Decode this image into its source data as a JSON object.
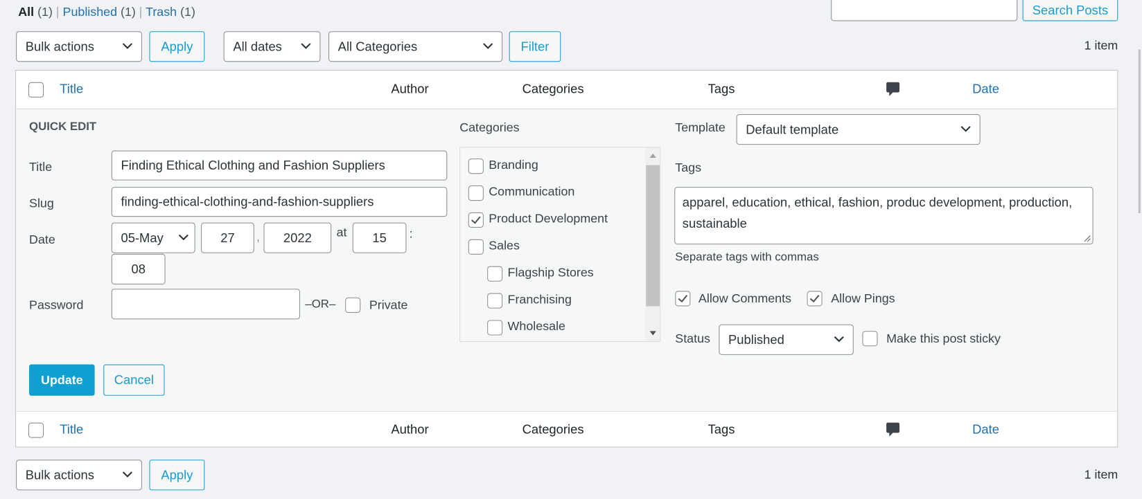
{
  "status_links": [
    {
      "label": "All",
      "count": "(1)",
      "current": true
    },
    {
      "label": "Published",
      "count": "(1)"
    },
    {
      "label": "Trash",
      "count": "(1)"
    }
  ],
  "search": {
    "value": "",
    "button": "Search Posts"
  },
  "top_nav": {
    "bulk_actions": "Bulk actions",
    "apply": "Apply",
    "dates": "All dates",
    "categories": "All Categories",
    "filter": "Filter",
    "count": "1 item"
  },
  "bottom_nav": {
    "bulk_actions": "Bulk actions",
    "apply": "Apply",
    "count": "1 item"
  },
  "columns": {
    "title": "Title",
    "author": "Author",
    "categories": "Categories",
    "tags": "Tags",
    "comments_icon": "comment-bubble-icon",
    "date": "Date"
  },
  "quick_edit": {
    "heading": "QUICK EDIT",
    "title_label": "Title",
    "title_value": "Finding Ethical Clothing and Fashion Suppliers",
    "slug_label": "Slug",
    "slug_value": "finding-ethical-clothing-and-fashion-suppliers",
    "date_label": "Date",
    "month": "05-May",
    "day": "27",
    "comma": ",",
    "year": "2022",
    "at": "at",
    "hour": "15",
    "colon": ":",
    "minute": "08",
    "password_label": "Password",
    "password_value": "",
    "or": "–OR–",
    "private_label": "Private",
    "private_checked": false,
    "categories_label": "Categories",
    "categories": [
      {
        "label": "Branding",
        "checked": false,
        "child": false
      },
      {
        "label": "Communication",
        "checked": false,
        "child": false
      },
      {
        "label": "Product Development",
        "checked": true,
        "child": false
      },
      {
        "label": "Sales",
        "checked": false,
        "child": false
      },
      {
        "label": "Flagship Stores",
        "checked": false,
        "child": true
      },
      {
        "label": "Franchising",
        "checked": false,
        "child": true
      },
      {
        "label": "Wholesale",
        "checked": false,
        "child": true
      }
    ],
    "template_label": "Template",
    "template_value": "Default template",
    "tags_label": "Tags",
    "tags_value": "apparel, education, ethical, fashion, produc development, production, sustainable",
    "tags_hint": "Separate tags with commas",
    "allow_comments": "Allow Comments",
    "allow_comments_checked": true,
    "allow_pings": "Allow Pings",
    "allow_pings_checked": true,
    "status_label": "Status",
    "status_value": "Published",
    "sticky_label": "Make this post sticky",
    "sticky_checked": false,
    "update": "Update",
    "cancel": "Cancel"
  },
  "colors": {
    "link": "#2271b1",
    "accent": "#1a9ccf",
    "primary_button": "#0ea0d0"
  }
}
